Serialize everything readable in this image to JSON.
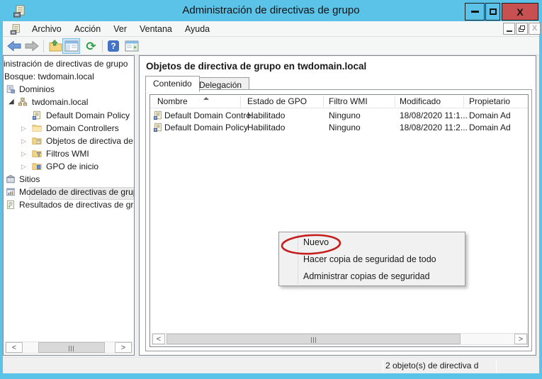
{
  "window": {
    "title": "Administración de directivas de grupo"
  },
  "menu": {
    "items": [
      {
        "label": "Archivo"
      },
      {
        "label": "Acción"
      },
      {
        "label": "Ver"
      },
      {
        "label": "Ventana"
      },
      {
        "label": "Ayuda"
      }
    ]
  },
  "toolbar": {
    "buttons": [
      {
        "name": "back"
      },
      {
        "name": "forward"
      },
      {
        "name": "export-list"
      },
      {
        "name": "show-console-tree",
        "selected": true
      },
      {
        "name": "refresh"
      },
      {
        "name": "help"
      },
      {
        "name": "show-action-pane"
      }
    ],
    "help_glyph": "?"
  },
  "tree": {
    "items": [
      {
        "label": "inistración de directivas de grupo"
      },
      {
        "label": "Bosque: twdomain.local"
      },
      {
        "label": "Dominios"
      },
      {
        "label": "twdomain.local",
        "state": "expanded"
      },
      {
        "label": "Default Domain Policy"
      },
      {
        "label": "Domain Controllers",
        "state": "collapsed"
      },
      {
        "label": "Objetos de directiva de g",
        "state": "collapsed",
        "selected": true
      },
      {
        "label": "Filtros WMI",
        "state": "collapsed"
      },
      {
        "label": "GPO de inicio",
        "state": "collapsed"
      },
      {
        "label": "Sitios"
      },
      {
        "label": "Modelado de directivas de grup"
      },
      {
        "label": "Resultados de directivas de grup"
      }
    ]
  },
  "content": {
    "title": "Objetos de directiva de grupo en twdomain.local",
    "tabs": [
      {
        "label": "Contenido",
        "active": true
      },
      {
        "label": "Delegación",
        "active": false
      }
    ],
    "table": {
      "columns": [
        "Nombre",
        "Estado de GPO",
        "Filtro WMI",
        "Modificado",
        "Propietario"
      ],
      "sort_column": "Nombre",
      "sort_direction": "ascending",
      "rows": [
        {
          "nombre": "Default Domain Contro...",
          "estado": "Habilitado",
          "filtro": "Ninguno",
          "modificado": "18/08/2020 11:1...",
          "propietario": "Domain Ad"
        },
        {
          "nombre": "Default Domain Policy",
          "estado": "Habilitado",
          "filtro": "Ninguno",
          "modificado": "18/08/2020 11:2...",
          "propietario": "Domain Ad"
        }
      ]
    }
  },
  "context_menu": {
    "items": [
      {
        "label": "Nuevo",
        "annotated": true
      },
      {
        "label": "Hacer copia de seguridad de todo"
      },
      {
        "label": "Administrar copias de seguridad"
      }
    ],
    "annotation": "red-ellipse",
    "annotation_color": "#c41e1e"
  },
  "status_bar": {
    "text": "2 objeto(s) de directiva d"
  },
  "colors": {
    "titlebar": "#5bc2e8",
    "close_button": "#c75050",
    "panel_border": "#828790",
    "selection": "#e9e9e9",
    "toolbar_selected": "#cde8f6"
  }
}
